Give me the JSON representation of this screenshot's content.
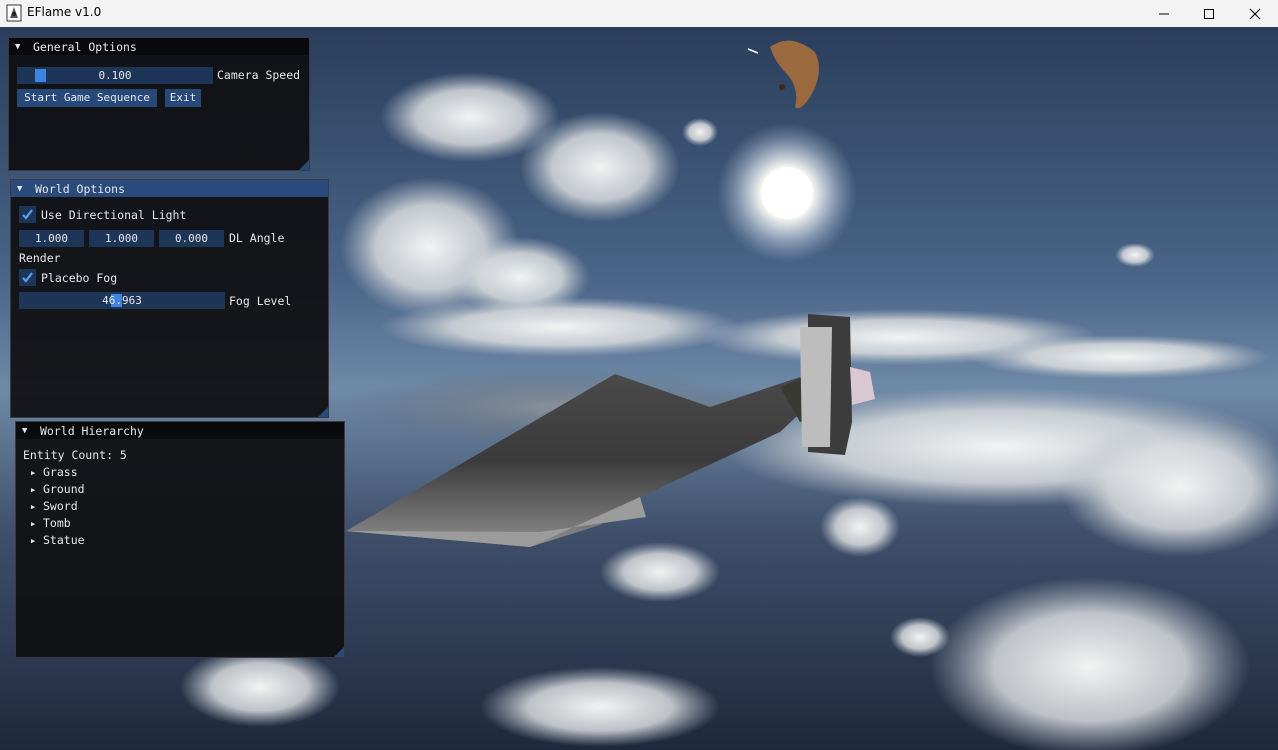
{
  "window": {
    "title": "EFlame v1.0"
  },
  "general_options": {
    "title": "General Options",
    "camera_speed_value": "0.100",
    "camera_speed_label": "Camera Speed",
    "start_button": "Start Game Sequence",
    "exit_button": "Exit"
  },
  "world_options": {
    "title": "World Options",
    "use_directional_light_label": "Use Directional Light",
    "use_directional_light_checked": true,
    "dl_angle": [
      "1.000",
      "1.000",
      "0.000"
    ],
    "dl_angle_label": "DL Angle",
    "render_label": "Render",
    "placebo_fog_label": "Placebo Fog",
    "placebo_fog_checked": true,
    "fog_level_value": "46.963",
    "fog_level_label": "Fog Level"
  },
  "world_hierarchy": {
    "title": "World Hierarchy",
    "entity_count_label": "Entity Count: 5",
    "entities": [
      "Grass",
      "Ground",
      "Sword",
      "Tomb",
      "Statue"
    ]
  },
  "colors": {
    "panel_bg": "#0f0f11",
    "active_header": "#294a7a",
    "field_bg": "#1d3557",
    "accent": "#3d84e0"
  }
}
